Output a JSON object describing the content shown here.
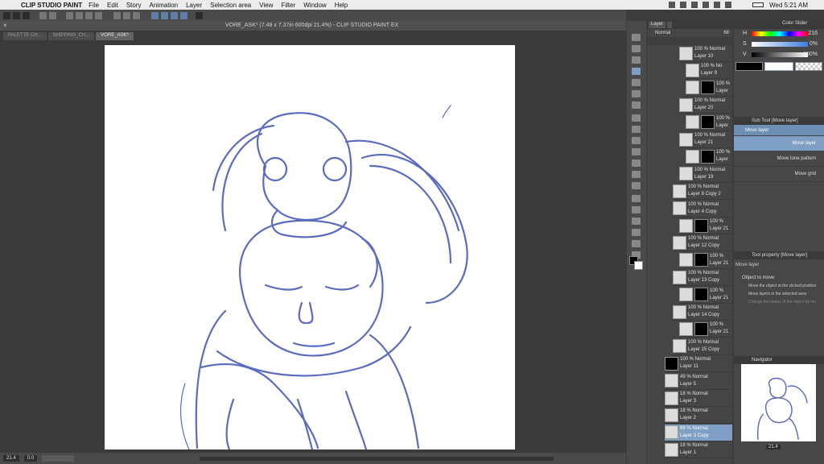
{
  "menubar": {
    "app_name": "CLIP STUDIO PAINT",
    "items": [
      "File",
      "Edit",
      "Story",
      "Animation",
      "Layer",
      "Selection area",
      "View",
      "Filter",
      "Window",
      "Help"
    ],
    "clock": "Wed 5:21 AM"
  },
  "window": {
    "title": "VORE_ASK* (7.48 x 7.37in 600dpi 21.4%)  - CLIP STUDIO PAINT EX",
    "tabs": [
      "PALETTE CH...",
      "SHIPPING_CH...",
      "VORE_ASK*"
    ]
  },
  "status": {
    "zoom": "21.4",
    "angle": "0.0"
  },
  "layer_panel": {
    "tab_label": "Layer",
    "blend_mode": "Normal",
    "opacity": "68",
    "layers": [
      {
        "line1": "100 % Normal",
        "line2": "Layer 10"
      },
      {
        "line1": "100 % No",
        "line2": "Layer 9"
      },
      {
        "line1": "100 %",
        "line2": "Layer"
      },
      {
        "line1": "100 % Normal",
        "line2": "Layer 20"
      },
      {
        "line1": "100 %",
        "line2": "Layer"
      },
      {
        "line1": "100 % Normal",
        "line2": "Layer 21"
      },
      {
        "line1": "100 %",
        "line2": "Layer"
      },
      {
        "line1": "100 % Normal",
        "line2": "Layer 19"
      },
      {
        "line1": "100 % Normal",
        "line2": "Layer 8 Copy 2"
      },
      {
        "line1": "100 % Normal",
        "line2": "Layer 4 Copy"
      },
      {
        "line1": "100 %",
        "line2": "Layer 21"
      },
      {
        "line1": "100 % Normal",
        "line2": "Layer 12 Copy"
      },
      {
        "line1": "100 %",
        "line2": "Layer 21"
      },
      {
        "line1": "100 % Normal",
        "line2": "Layer 13 Copy"
      },
      {
        "line1": "100 %",
        "line2": "Layer 21"
      },
      {
        "line1": "100 % Normal",
        "line2": "Layer 14 Copy"
      },
      {
        "line1": "100 %",
        "line2": "Layer 21"
      },
      {
        "line1": "100 % Normal",
        "line2": "Layer 15 Copy"
      },
      {
        "line1": "100 % Normal",
        "line2": "Layer 11"
      },
      {
        "line1": "49 % Normal",
        "line2": "Layer 5"
      },
      {
        "line1": "18 % Normal",
        "line2": "Layer 3"
      },
      {
        "line1": "18 % Normal",
        "line2": "Layer 2"
      },
      {
        "line1": "68 % Normal",
        "line2": "Layer 3 Copy"
      },
      {
        "line1": "18 % Normal",
        "line2": "Layer 1"
      }
    ]
  },
  "color_panel": {
    "tabs": [
      "Color Slider"
    ],
    "sliders": [
      {
        "label": "H",
        "value": "216"
      },
      {
        "label": "S",
        "value": "0%"
      },
      {
        "label": "V",
        "value": "100%"
      }
    ]
  },
  "sub_tool": {
    "title": "Sub Tool [Move layer]",
    "group": "Move layer",
    "items": [
      "Move layer",
      "Move tone pattern",
      "Move grid"
    ]
  },
  "tool_property": {
    "title": "Tool property [Move layer]",
    "name": "Move layer",
    "object_label": "Object to move",
    "options": [
      "Move the object at the clicked position",
      "Move layers in the selected area",
      "Change the status of the object by mo"
    ]
  },
  "navigator": {
    "title": "Navigator",
    "zoom": "21.4"
  },
  "colors": {
    "stroke": "#5b6bbf",
    "selected": "#7fa0c4"
  }
}
